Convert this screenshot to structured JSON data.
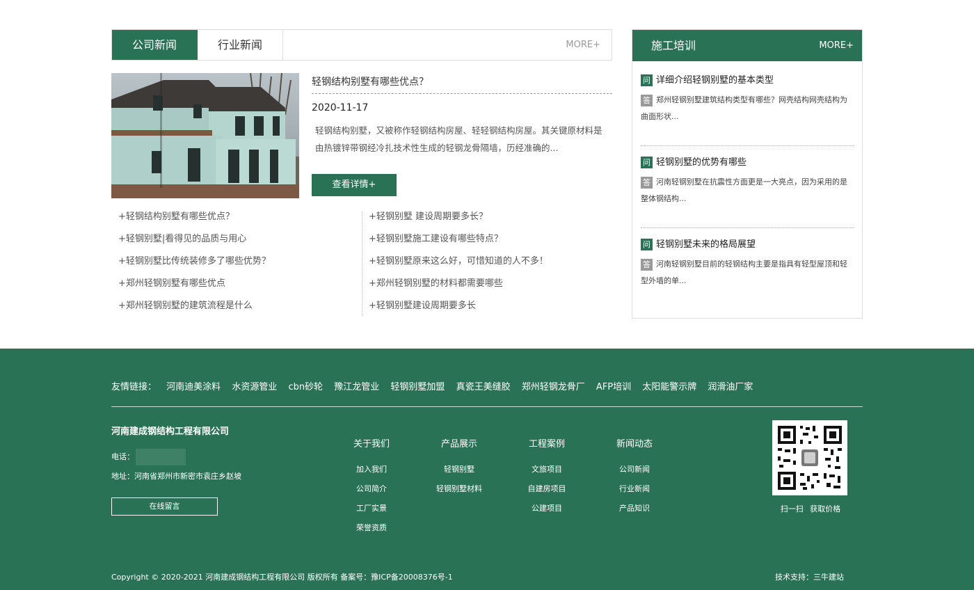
{
  "news": {
    "tabs": [
      "公司新闻",
      "行业新闻"
    ],
    "more": "MORE+",
    "featured": {
      "title": "轻钢结构别墅有哪些优点？",
      "date": "2020-11-17",
      "desc": "轻钢结构别墅，又被称作轻钢结构房屋、轻轻钢结构房屋。其关键原材料是由热镀锌带钢经冷扎技术性生成的轻钢龙骨隔墙，历经准确的...",
      "button": "查看详情+"
    },
    "left_list": [
      "+轻钢结构别墅有哪些优点？",
      "+轻钢别墅|看得见的品质与用心",
      "+轻钢别墅比传统装修多了哪些优势？",
      "+郑州轻钢别墅有哪些优点",
      "+郑州轻钢别墅的建筑流程是什么"
    ],
    "right_list": [
      "+轻钢别墅 建设周期要多长？",
      "+轻钢别墅施工建设有哪些特点？",
      "+轻钢别墅原来这么好，可惜知道的人不多！",
      "+郑州轻钢别墅的材料都需要哪些",
      "+轻钢别墅建设周期要多长"
    ]
  },
  "training": {
    "title": "施工培训",
    "more": "MORE+",
    "q_badge": "问",
    "a_badge": "答",
    "items": [
      {
        "q": "详细介绍轻钢别墅的基本类型",
        "a": "郑州轻钢别墅建筑结构类型有哪些？网壳结构网壳结构为曲面形状..."
      },
      {
        "q": "轻钢别墅的优势有哪些",
        "a": "河南轻钢别墅在抗震性方面更是一大亮点，因为采用的是整体钢结构..."
      },
      {
        "q": "轻钢别墅未来的格局展望",
        "a": "河南轻钢别墅目前的轻钢结构主要是指具有轻型屋顶和轻型外墙的单..."
      }
    ]
  },
  "footer": {
    "links_label": "友情链接：",
    "links": [
      "河南迪美涂料",
      "水资源管业",
      "cbn砂轮",
      "豫江龙管业",
      "轻钢别墅加盟",
      "真瓷王美缝胶",
      "郑州轻钢龙骨厂",
      "AFP培训",
      "太阳能警示牌",
      "润滑油厂家"
    ],
    "company": "河南建成钢结构工程有限公司",
    "tel_label": "电话：",
    "address": "地址：河南省郑州市新密市袁庄乡赵坡",
    "message_button": "在线留言",
    "columns": [
      {
        "title": "关于我们",
        "items": [
          "加入我们",
          "公司简介",
          "工厂实景",
          "荣誉资质"
        ]
      },
      {
        "title": "产品展示",
        "items": [
          "轻钢别墅",
          "轻钢别墅材料"
        ]
      },
      {
        "title": "工程案例",
        "items": [
          "文旅项目",
          "自建房项目",
          "公建项目"
        ]
      },
      {
        "title": "新闻动态",
        "items": [
          "公司新闻",
          "行业新闻",
          "产品知识"
        ]
      }
    ],
    "qr_text": "扫一扫 获取价格",
    "copyright": "Copyright © 2020-2021 河南建成钢结构工程有限公司 版权所有 备案号：豫ICP备20008376号-1",
    "support": "技术支持：三牛建站"
  },
  "colors": {
    "brand_green": "#2a7255",
    "white": "#ffffff",
    "text": "#333333"
  }
}
